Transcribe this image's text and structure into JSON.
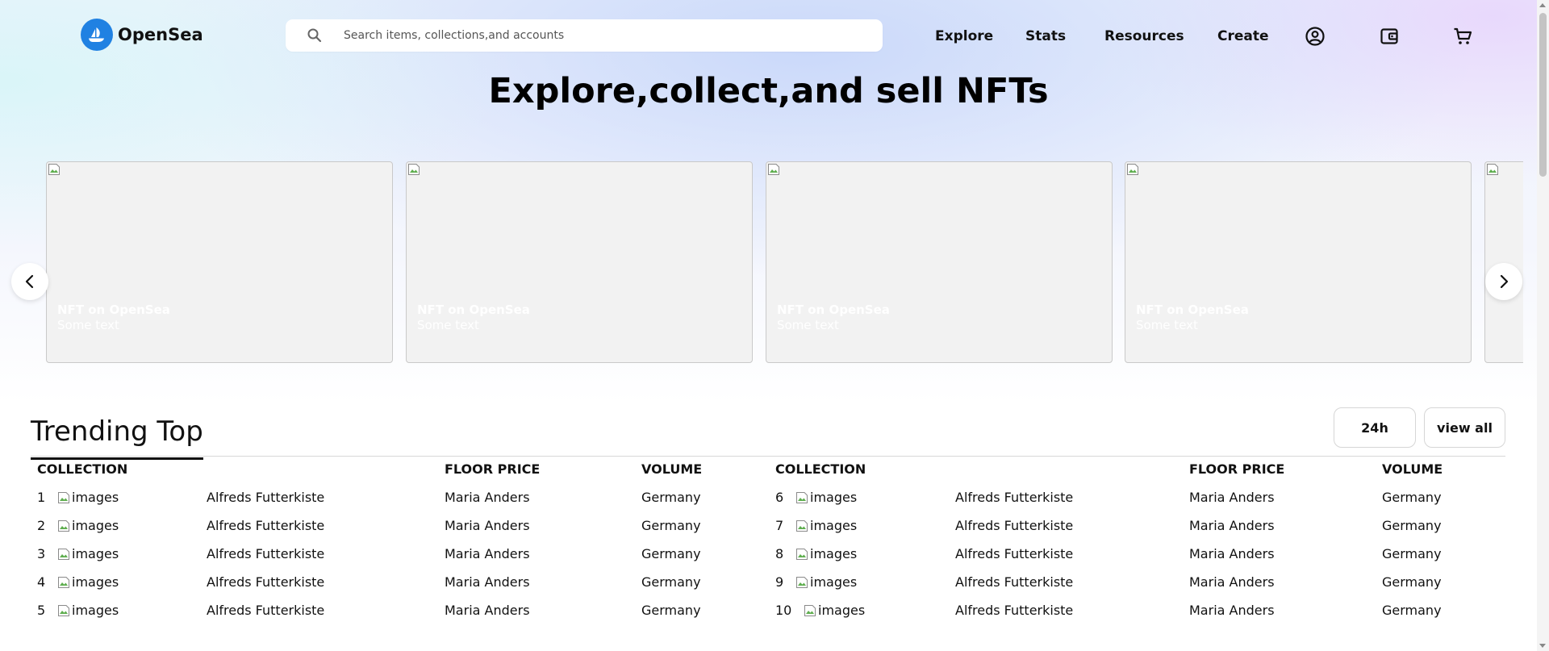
{
  "header": {
    "brand": "OpenSea",
    "search_placeholder": "Search items, collections,and accounts",
    "nav": [
      "Explore",
      "Stats",
      "Resources",
      "Create"
    ],
    "icons": [
      "account-icon",
      "wallet-icon",
      "cart-icon"
    ]
  },
  "hero": {
    "title": "Explore,collect,and sell NFTs"
  },
  "carousel": {
    "cards": [
      {
        "title": "NFT on OpenSea",
        "subtitle": "Some text"
      },
      {
        "title": "NFT on OpenSea",
        "subtitle": "Some text"
      },
      {
        "title": "NFT on OpenSea",
        "subtitle": "Some text"
      },
      {
        "title": "NFT on OpenSea",
        "subtitle": "Some text"
      },
      {
        "title": "",
        "subtitle": ""
      }
    ],
    "prev_icon": "chevron-left-icon",
    "next_icon": "chevron-right-icon"
  },
  "trending": {
    "tab_label": "Trending Top",
    "period_label": "24h",
    "view_all_label": "view all",
    "columns": [
      "COLLECTION",
      "FLOOR PRICE",
      "VOLUME"
    ],
    "left_rows": [
      {
        "rank": "1",
        "image_alt": "images",
        "name": "Alfreds Futterkiste",
        "floor": "Maria Anders",
        "volume": "Germany"
      },
      {
        "rank": "2",
        "image_alt": "images",
        "name": "Alfreds Futterkiste",
        "floor": "Maria Anders",
        "volume": "Germany"
      },
      {
        "rank": "3",
        "image_alt": "images",
        "name": "Alfreds Futterkiste",
        "floor": "Maria Anders",
        "volume": "Germany"
      },
      {
        "rank": "4",
        "image_alt": "images",
        "name": "Alfreds Futterkiste",
        "floor": "Maria Anders",
        "volume": "Germany"
      },
      {
        "rank": "5",
        "image_alt": "images",
        "name": "Alfreds Futterkiste",
        "floor": "Maria Anders",
        "volume": "Germany"
      }
    ],
    "right_rows": [
      {
        "rank": "6",
        "image_alt": "images",
        "name": "Alfreds Futterkiste",
        "floor": "Maria Anders",
        "volume": "Germany"
      },
      {
        "rank": "7",
        "image_alt": "images",
        "name": "Alfreds Futterkiste",
        "floor": "Maria Anders",
        "volume": "Germany"
      },
      {
        "rank": "8",
        "image_alt": "images",
        "name": "Alfreds Futterkiste",
        "floor": "Maria Anders",
        "volume": "Germany"
      },
      {
        "rank": "9",
        "image_alt": "images",
        "name": "Alfreds Futterkiste",
        "floor": "Maria Anders",
        "volume": "Germany"
      },
      {
        "rank": "10",
        "image_alt": "images",
        "name": "Alfreds Futterkiste",
        "floor": "Maria Anders",
        "volume": "Germany"
      }
    ]
  },
  "colors": {
    "brand_blue": "#2081e2",
    "text": "#111111",
    "card_bg": "#f2f2f2"
  }
}
